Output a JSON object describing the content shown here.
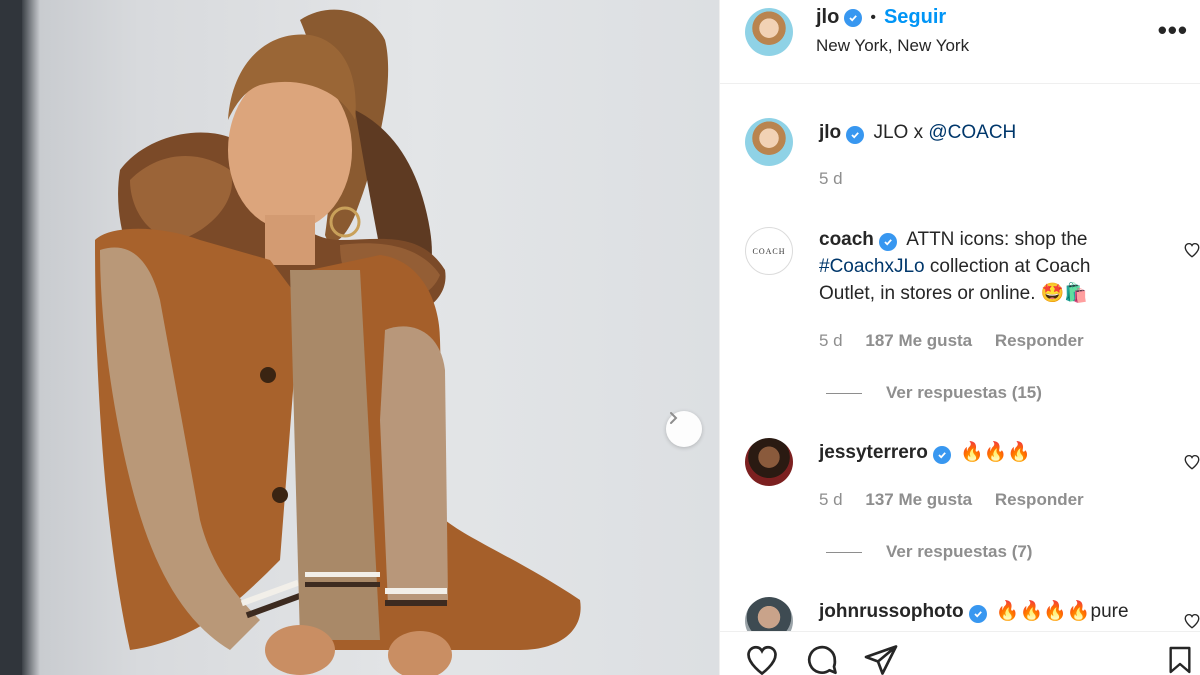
{
  "post": {
    "username": "jlo",
    "follow_label": "Seguir",
    "separator": "•",
    "location": "New York, New York",
    "more_label": "•••"
  },
  "caption": {
    "username": "jlo",
    "text": "JLO x ",
    "mention": "@COACH",
    "time": "5 d"
  },
  "comments": [
    {
      "username": "coach",
      "avatar_text": "COACH",
      "text_part1": "ATTN icons: shop the",
      "hashtag": "#CoachxJLo",
      "text_part2": " collection at Coach",
      "text_part3": "Outlet, in stores or online. 🤩🛍️",
      "time": "5 d",
      "likes": "187 Me gusta",
      "reply": "Responder",
      "view_replies": "Ver respuestas (15)"
    },
    {
      "username": "jessyterrero",
      "text": "🔥🔥🔥",
      "time": "5 d",
      "likes": "137 Me gusta",
      "reply": "Responder",
      "view_replies": "Ver respuestas (7)"
    },
    {
      "username": "johnrussophoto",
      "text": "🔥🔥🔥🔥pure"
    }
  ],
  "icons": {
    "verified": "verified-badge-icon",
    "carousel_next": "chevron-right-icon",
    "like": "heart-icon",
    "comment": "comment-icon",
    "share": "paper-plane-icon",
    "save": "bookmark-icon"
  },
  "colors": {
    "accent": "#0095f6",
    "verified": "#3897f0",
    "muted": "#8e8e8e",
    "link": "#00376b"
  }
}
